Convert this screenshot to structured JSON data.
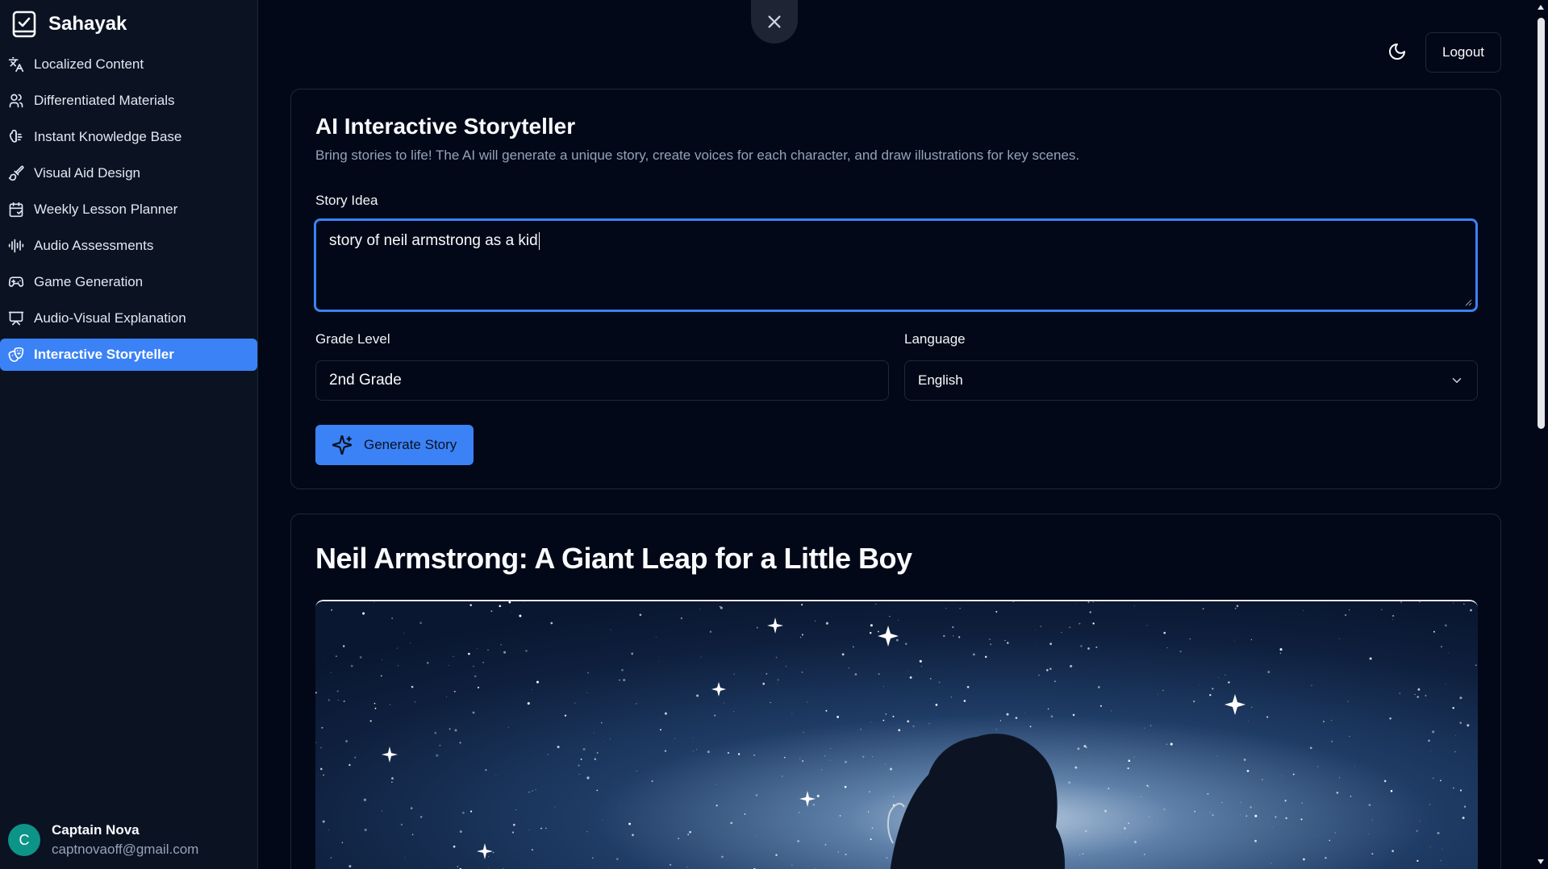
{
  "app": {
    "name": "Sahayak"
  },
  "sidebar": {
    "items": [
      {
        "label": "Localized Content",
        "icon": "translate-icon"
      },
      {
        "label": "Differentiated Materials",
        "icon": "users-icon"
      },
      {
        "label": "Instant Knowledge Base",
        "icon": "brain-icon"
      },
      {
        "label": "Visual Aid Design",
        "icon": "brush-icon"
      },
      {
        "label": "Weekly Lesson Planner",
        "icon": "calendar-icon"
      },
      {
        "label": "Audio Assessments",
        "icon": "audio-lines-icon"
      },
      {
        "label": "Game Generation",
        "icon": "gamepad-icon"
      },
      {
        "label": "Audio-Visual Explanation",
        "icon": "presentation-icon"
      },
      {
        "label": "Interactive Storyteller",
        "icon": "drama-icon",
        "active": true
      }
    ]
  },
  "user": {
    "initial": "C",
    "name": "Captain Nova",
    "email": "captnovaoff@gmail.com"
  },
  "header": {
    "logout_label": "Logout",
    "theme_icon": "moon-icon",
    "close_icon": "close-icon"
  },
  "form": {
    "title": "AI Interactive Storyteller",
    "description": "Bring stories to life! The AI will generate a unique story, create voices for each character, and draw illustrations for key scenes.",
    "story_idea_label": "Story Idea",
    "story_idea_value": "story of neil armstrong as a kid",
    "grade_label": "Grade Level",
    "grade_value": "2nd Grade",
    "language_label": "Language",
    "language_value": "English",
    "generate_label": "Generate Story"
  },
  "story": {
    "title": "Neil Armstrong: A Giant Leap for a Little Boy"
  },
  "colors": {
    "accent": "#3b82f6",
    "background": "#020817",
    "sidebar": "#0b1222",
    "border": "#1e293b"
  }
}
